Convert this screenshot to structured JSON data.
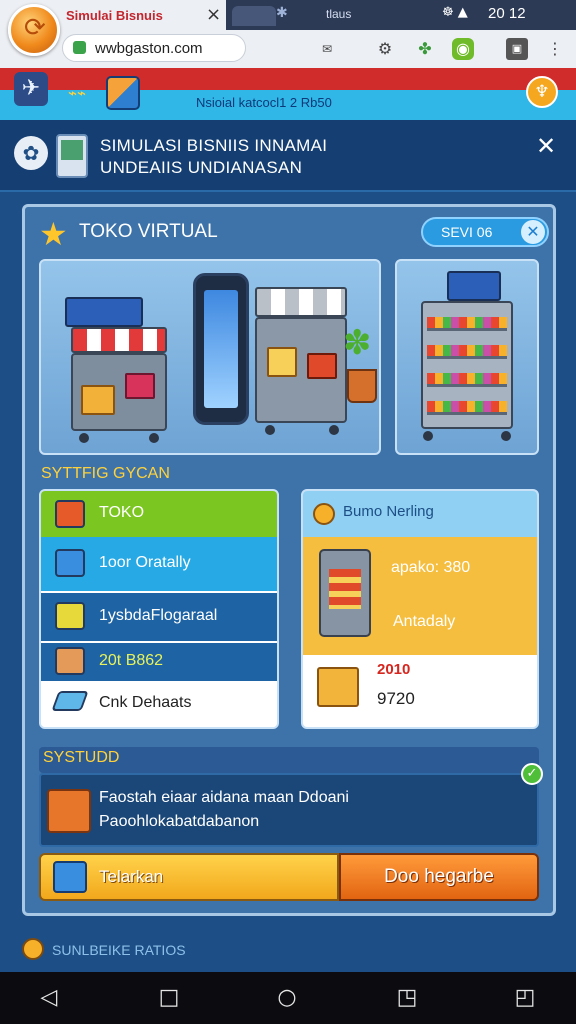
{
  "browser": {
    "tab_title": "Simulai Bisnuis",
    "tab_label_2": "tlaus",
    "status_time": "20 12",
    "url": "wwbgaston.com"
  },
  "gamebar": {
    "title": "Nsioial katcocl1 2 Rb50"
  },
  "header": {
    "title_line1": "SIMULASI BISNIIS INNAMAI",
    "title_line2": "UNDEAIIS UNDIANASAN"
  },
  "panel": {
    "title": "TOKO VIRTUAL",
    "pill_label": "SEVI 06"
  },
  "list": {
    "section_label": "SYTTFIG GYCAN",
    "items": [
      {
        "label": "TOKO",
        "bg": "#7cc621",
        "color": "#ffffff",
        "icon": "brick-icon",
        "icon_color": "#e65a2a"
      },
      {
        "label": "1oor Oratally",
        "bg": "#27a9e6",
        "color": "#ffffff",
        "icon": "bag-icon",
        "icon_color": "#3a8ee0"
      },
      {
        "label": "1ysbdaFlogaraal",
        "bg": "#1e63a3",
        "color": "#ffffff",
        "icon": "crate-icon",
        "icon_color": "#e8d93a"
      },
      {
        "label": "20t B862",
        "bg": "#1e63a3",
        "color": "#e8f25a",
        "icon": "parcel-icon",
        "icon_color": "#e49b5a"
      },
      {
        "label": "Cnk Dehaats",
        "bg": "#ffffff",
        "color": "#222222",
        "icon": "card-icon",
        "icon_color": "#5fb6e8"
      }
    ]
  },
  "stats": {
    "heading": "Bumo Nerling",
    "value_1": "apako: 380",
    "value_2": "Antadaly",
    "value_red": "2010",
    "value_black": "9720"
  },
  "system": {
    "section_label": "SYSTUDD",
    "notice_line1": "Faostah eiaar aidana maan Ddoani",
    "notice_line2": "Paoohlokabatdabanon"
  },
  "buttons": {
    "left_label": "Telarkan",
    "right_label": "Doo hegarbe"
  },
  "footer": {
    "text": "SUNLBEIKE RATIOS"
  }
}
